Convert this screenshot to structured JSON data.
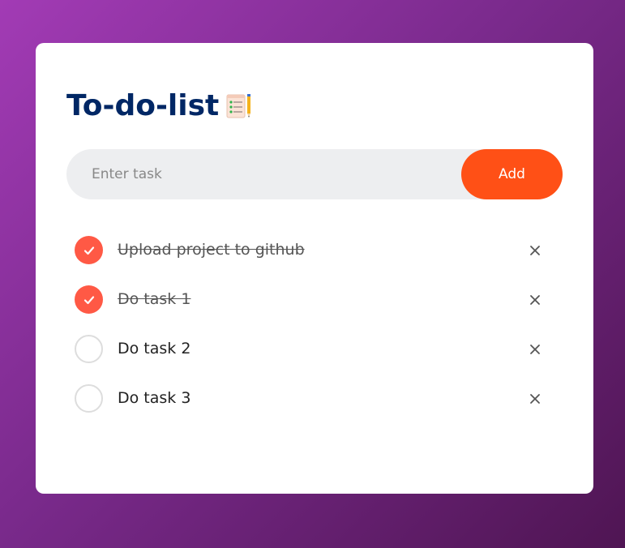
{
  "app": {
    "title": "To-do-list",
    "title_icon": "notepad-pencil-icon"
  },
  "colors": {
    "title": "#002765",
    "accent": "#ff5016",
    "check_done": "#ff5945",
    "input_bg": "#edeef0"
  },
  "input": {
    "placeholder": "Enter task",
    "value": ""
  },
  "add_button": {
    "label": "Add"
  },
  "tasks": [
    {
      "text": "Upload project to github",
      "done": true,
      "remove_icon": "close-icon"
    },
    {
      "text": "Do task 1",
      "done": true,
      "remove_icon": "close-icon"
    },
    {
      "text": "Do task 2",
      "done": false,
      "remove_icon": "close-icon"
    },
    {
      "text": "Do task 3",
      "done": false,
      "remove_icon": "close-icon"
    }
  ]
}
